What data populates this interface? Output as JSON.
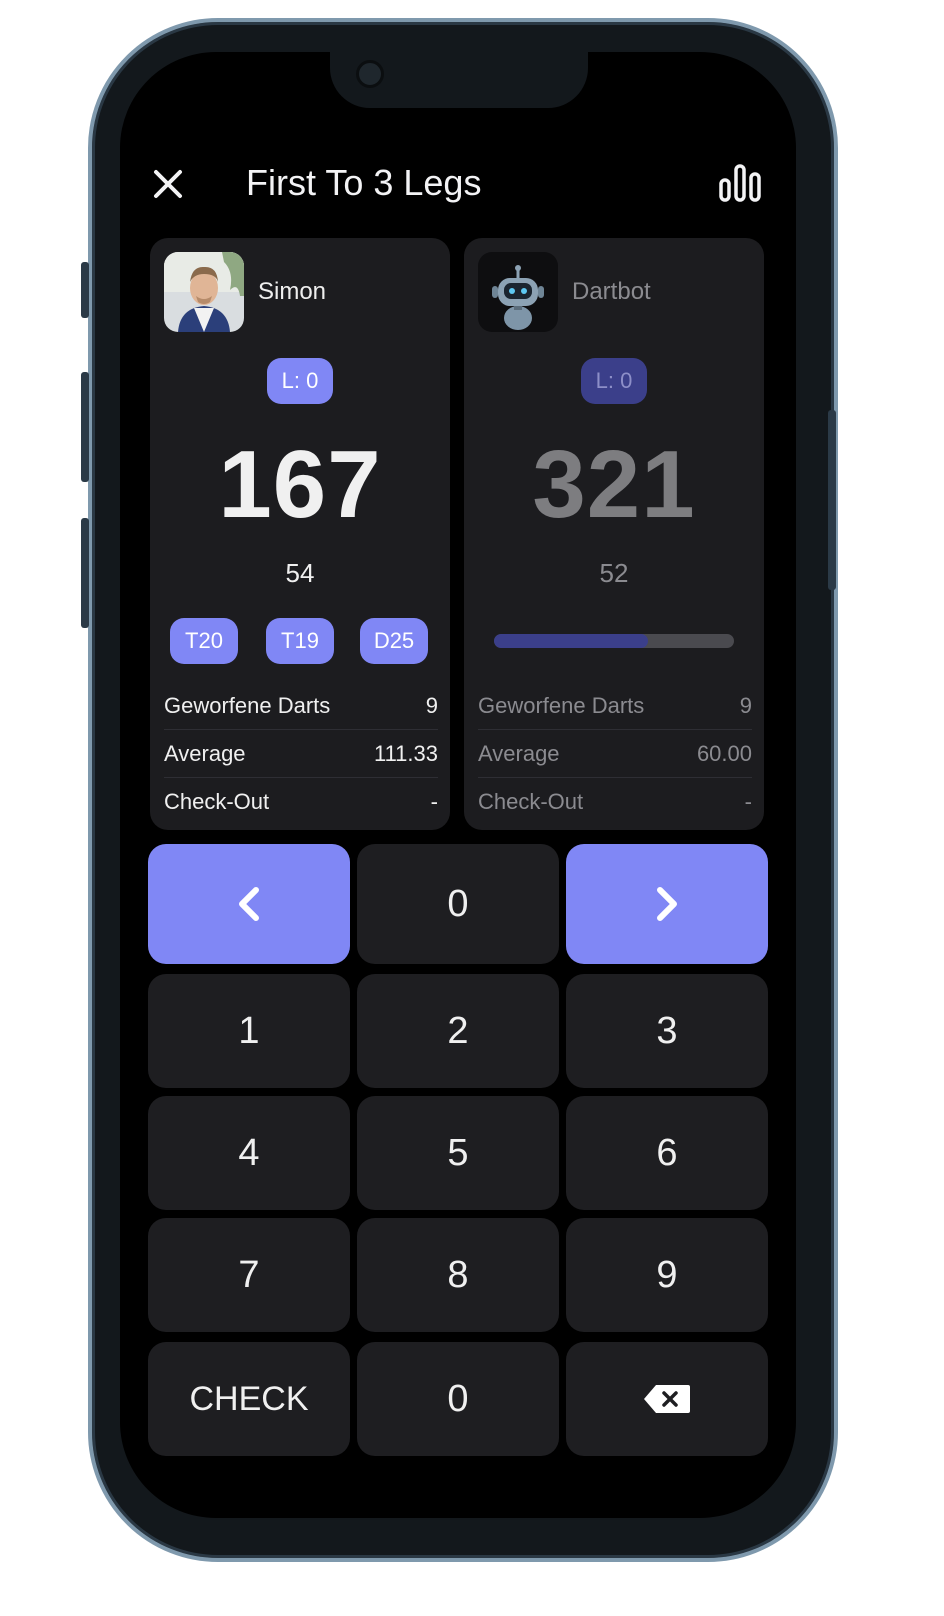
{
  "header": {
    "title": "First To 3 Legs",
    "close_icon": "close-icon",
    "stats_icon": "bar-chart-icon"
  },
  "players": [
    {
      "name": "Simon",
      "legs": "L: 0",
      "score": "167",
      "last_score": "54",
      "checkout_suggestions": [
        "T20",
        "T19",
        "D25"
      ],
      "stats": [
        {
          "label": "Geworfene Darts",
          "value": "9"
        },
        {
          "label": "Average",
          "value": "111.33"
        },
        {
          "label": "Check-Out",
          "value": "-"
        }
      ]
    },
    {
      "name": "Dartbot",
      "legs": "L: 0",
      "score": "321",
      "last_score": "52",
      "progress": 0.64,
      "stats": [
        {
          "label": "Geworfene Darts",
          "value": "9"
        },
        {
          "label": "Average",
          "value": "60.00"
        },
        {
          "label": "Check-Out",
          "value": "-"
        }
      ]
    }
  ],
  "keypad": {
    "top_row": {
      "prev_icon": "chevron-left-icon",
      "input": "0",
      "next_icon": "chevron-right-icon"
    },
    "digits": [
      "1",
      "2",
      "3",
      "4",
      "5",
      "6",
      "7",
      "8",
      "9"
    ],
    "check_label": "CHECK",
    "zero_label": "0",
    "backspace_icon": "backspace-icon"
  },
  "colors": {
    "accent": "#8087f5",
    "accent_dim": "#3b3f8a",
    "card_bg": "#1c1c1f",
    "key_bg": "#1e1e21"
  }
}
